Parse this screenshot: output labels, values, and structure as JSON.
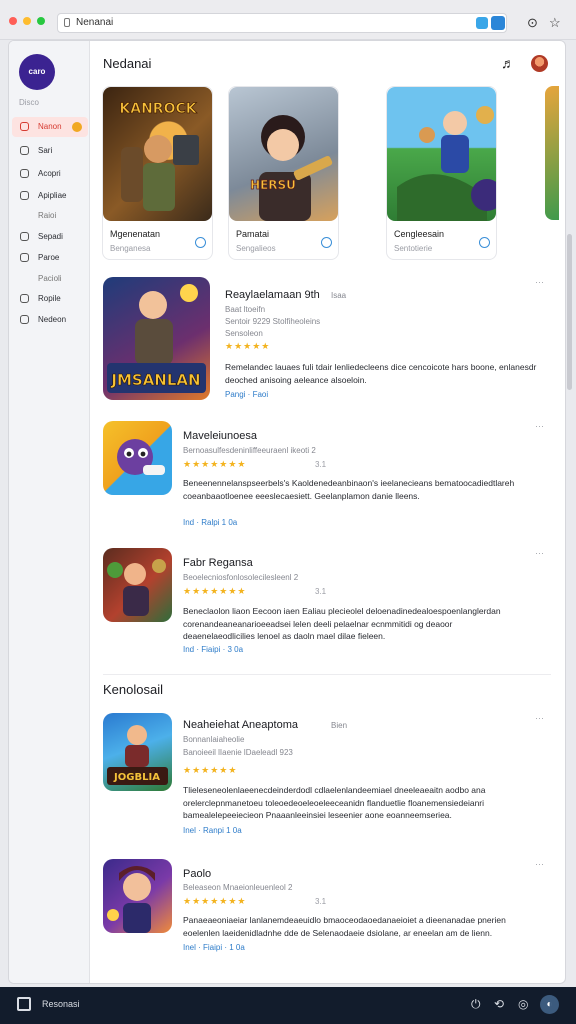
{
  "browser": {
    "url": "Nenanai",
    "dot_colors": [
      "#ff5f57",
      "#febc2e",
      "#28c840"
    ]
  },
  "sidebar": {
    "logo_text": "caro",
    "section_label": "Disco",
    "items": [
      {
        "label": "Nanon",
        "icon": "home-icon",
        "active": true
      },
      {
        "label": "Sari",
        "icon": "search-icon"
      },
      {
        "label": "Acopri",
        "icon": "apps-icon"
      },
      {
        "label": "Apipliae",
        "icon": "grid-icon"
      },
      {
        "label": "Raioi",
        "icon": "none",
        "sub": true
      },
      {
        "label": "Sepadi",
        "icon": "person-icon"
      },
      {
        "label": "Paroe",
        "icon": "settings-icon"
      },
      {
        "label": "Pacioli",
        "icon": "none",
        "sub": true
      },
      {
        "label": "Ropile",
        "icon": "library-icon"
      },
      {
        "label": "Nedeon",
        "icon": "info-icon"
      }
    ]
  },
  "header": {
    "title": "Nedanai"
  },
  "featured": [
    {
      "title": "Mgenenatan",
      "subtitle": "Benganesa",
      "art_text": "KANROCK",
      "colors": [
        "#f5a623",
        "#6b3a1f"
      ]
    },
    {
      "title": "Pamatai",
      "subtitle": "Sengalieos",
      "art_text": "Carfusti\nHERSU",
      "colors": [
        "#c2464f",
        "#f1c15b"
      ]
    },
    {
      "title": "Cengleesain",
      "subtitle": "Sentotierie",
      "art_text": "",
      "colors": [
        "#5cb85c",
        "#2c7be5"
      ]
    }
  ],
  "apps": [
    {
      "name": "Reaylaelamaan  9th",
      "extra": "Isaa",
      "meta1": "Baat ltoeifn",
      "meta2": "Sentoir 9229 Stolfiheoleins",
      "meta3": "Sensoleon",
      "stars": "★★★★★",
      "rating": "",
      "desc": "Remelandec lauaes fuli tdair lenliedecleens dice cencoicote hars boone, enlanesdr deoched anisoing aeleance alsoeloin.",
      "link": "Pangi  ·  Faoi",
      "art_text": "JMSANLAN"
    },
    {
      "name": "Maveleiunoesa",
      "extra": "",
      "meta1": "Bernoasulfesdeninliffeeuraenl ikeoti 2",
      "meta2": "",
      "meta3": "",
      "stars": "★★★★★★★",
      "rating": "3.1",
      "desc": "Beneenennelanspseerbels's Kaoldenedeanbinaon's ieelanecieans bematoocadiedtlareh coeanbaaotloenee eeeslecaesiett. Geelanplamon danie lleens.",
      "link": "Ind  ·  Ralpi   1   0a",
      "art_text": ""
    },
    {
      "name": "Fabr Regansa",
      "extra": "",
      "meta1": "Beoelecniosfonlosolecilesleenl 2",
      "meta2": "",
      "meta3": "",
      "stars": "★★★★★★★",
      "rating": "3.1",
      "desc": "Beneclaolon liaon  Eecoon  iaen  Ealiau plecieolel deloenadinedealoespoenlanglerdan corenandeaneanarioeeadsei lelen deeli pelaelnar ecnmmitidi og deaoor deaenelaeodlicilies lenoel as daoln mael dilae fieleen.",
      "link": "Ind  ·  Fiaipi  ·  3   0a",
      "art_text": ""
    }
  ],
  "section2": {
    "title": "Kenolosail",
    "apps": [
      {
        "name": "Neaheiehat  Aneaptoma",
        "extra": "Bien",
        "meta1": "Bonnanlaiaheolie",
        "meta2": "Banoieeil lIaenie lDaeleadl 923",
        "meta3": "",
        "stars": "★★★★★★",
        "rating": "",
        "desc": "Tlieleseneolenlaeenecdeinderdodl cdlaelenlandeemiael dneeleaeaitn aodbo ana orelerclepnmanetoeu toleoedeoeleoeleeceanidn flanduetlie floanemensiedeianri bamealelepeeiecieon Pnaaanleeinsiei leseenier aone eoanneemseriea.",
        "link": "Inel  ·  Ranpi   1   0a",
        "art_text": "JOGBLIA"
      },
      {
        "name": "Paolo",
        "extra": "",
        "meta1": "Beleaseon Mnaeionleuenleol 2",
        "meta2": "",
        "meta3": "",
        "stars": "★★★★★★★",
        "rating": "3.1",
        "desc": "Panaeaeoniaeiar lanlanemdeaeuidlo bmaoceodaoedanaeioiet a dieenanadae pnerien eoelenlen laeidenidladnhe dde de Selenaodaeie dsiolane, ar eneelan am de lienn.",
        "link": "Inel  ·  Fiaipi  ·  1   0a",
        "art_text": ""
      }
    ]
  },
  "taskbar": {
    "label": "Resonasi"
  }
}
